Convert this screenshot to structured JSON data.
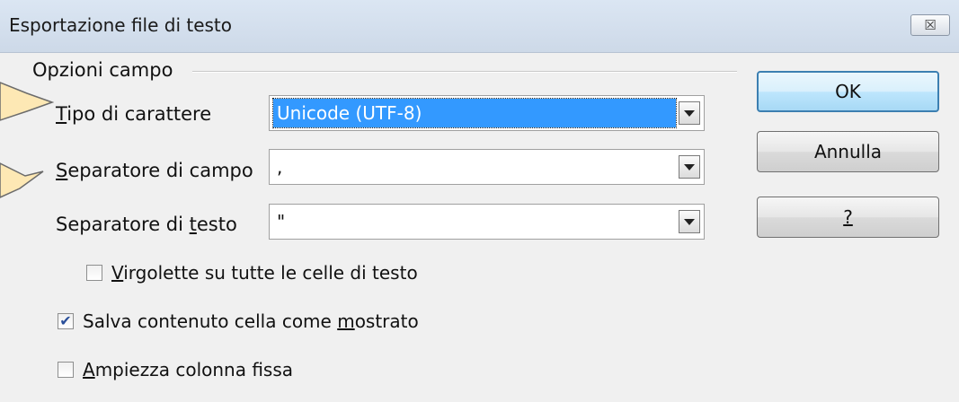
{
  "window": {
    "title": "Esportazione file di testo",
    "close_glyph": "☒"
  },
  "group": {
    "label": "Opzioni campo"
  },
  "fields": {
    "charset": {
      "label_mnemonic": "T",
      "label_rest": "ipo di carattere",
      "value": "Unicode (UTF-8)"
    },
    "field_sep": {
      "label_mnemonic": "S",
      "label_rest": "eparatore di campo",
      "value": ","
    },
    "text_sep": {
      "label_pre": "Separatore di ",
      "label_mnemonic": "t",
      "label_rest": "esto",
      "value": "\""
    }
  },
  "checkboxes": {
    "quote_all": {
      "mnemonic": "V",
      "rest": "irgolette su tutte le celle di testo",
      "checked": false
    },
    "save_as_shown": {
      "pre": "Salva contenuto cella come ",
      "mnemonic": "m",
      "rest": "ostrato",
      "checked": true,
      "check_glyph": "✔"
    },
    "fixed_width": {
      "mnemonic": "A",
      "rest": "mpiezza colonna fissa",
      "checked": false
    }
  },
  "buttons": {
    "ok": "OK",
    "cancel": "Annulla",
    "help": "?"
  },
  "colors": {
    "selection": "#3399ff",
    "callout_fill": "#fde8b4",
    "default_button_border": "#3c7fb1"
  }
}
